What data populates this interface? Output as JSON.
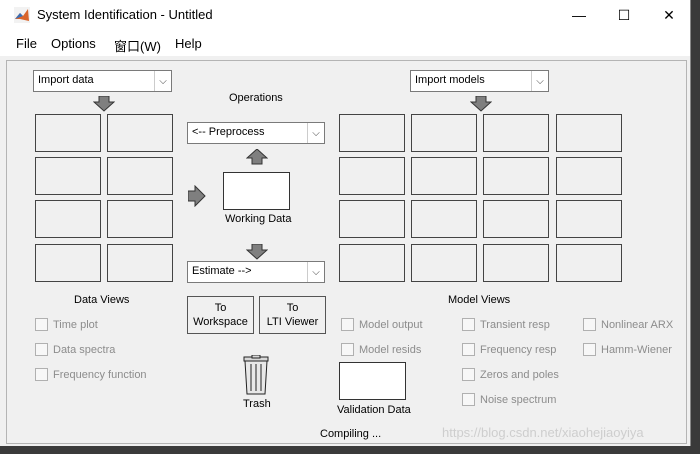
{
  "window": {
    "title": "System Identification - Untitled",
    "minimize": "—",
    "maximize": "☐",
    "close": "✕"
  },
  "menu": [
    "File",
    "Options",
    "窗口(W)",
    "Help"
  ],
  "data_side": {
    "import_dropdown": "Import data",
    "views_label": "Data Views",
    "views": [
      "Time plot",
      "Data spectra",
      "Frequency function"
    ]
  },
  "operations": {
    "label": "Operations",
    "preprocess": "<-- Preprocess",
    "working_data": "Working Data",
    "estimate": "Estimate -->",
    "to_workspace": [
      "To",
      "Workspace"
    ],
    "to_lti": [
      "To",
      "LTI Viewer"
    ],
    "trash": "Trash"
  },
  "model_side": {
    "import_dropdown": "Import models",
    "views_label": "Model Views",
    "col1": [
      "Model output",
      "Model resids"
    ],
    "col2": [
      "Transient resp",
      "Frequency resp",
      "Zeros and poles",
      "Noise spectrum"
    ],
    "col3": [
      "Nonlinear ARX",
      "Hamm-Wiener"
    ],
    "validation_data": "Validation Data"
  },
  "status": "Compiling ...",
  "watermark": "https://blog.csdn.net/xiaohejiaoyiya"
}
